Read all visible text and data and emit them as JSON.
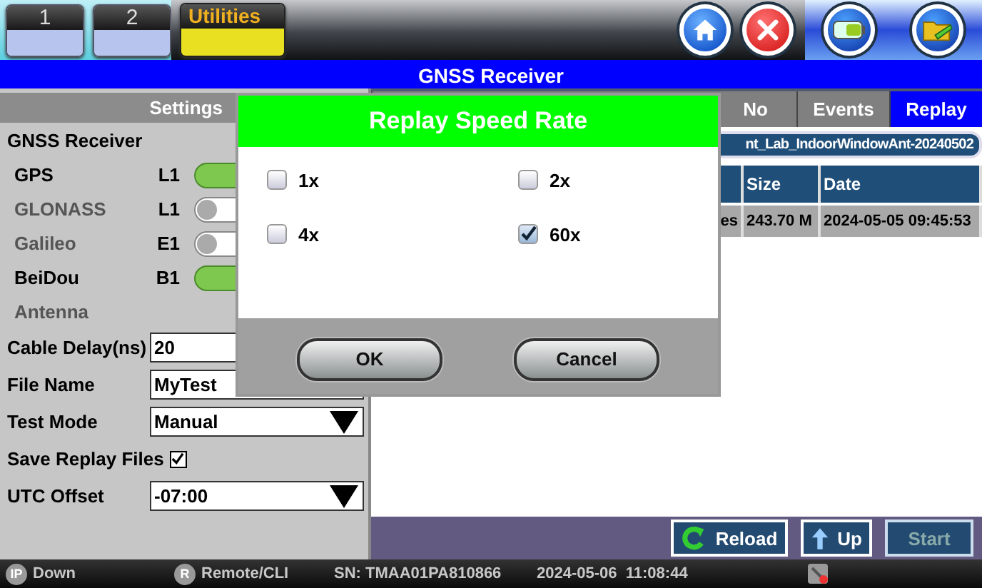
{
  "top_bar": {
    "tabs": [
      {
        "label": "1",
        "selected": false
      },
      {
        "label": "2",
        "selected": false
      },
      {
        "label": "Utilities",
        "selected": true
      }
    ]
  },
  "title_bar": {
    "title": "GNSS Receiver"
  },
  "settings": {
    "header": "Settings",
    "section": "GNSS Receiver",
    "constellations": [
      {
        "name": "GPS",
        "band": "L1",
        "on": true
      },
      {
        "name": "GLONASS",
        "band": "L1",
        "on": false
      },
      {
        "name": "Galileo",
        "band": "E1",
        "on": false
      },
      {
        "name": "BeiDou",
        "band": "B1",
        "on": true
      }
    ],
    "antenna_label": "Antenna",
    "fields": [
      {
        "kind": "text",
        "label": "Cable Delay(ns)",
        "value": "20"
      },
      {
        "kind": "text",
        "label": "File Name",
        "value": "MyTest"
      },
      {
        "kind": "select",
        "label": "Test Mode",
        "value": "Manual"
      },
      {
        "kind": "checkbox",
        "label": "Save Replay Files",
        "checked": true
      },
      {
        "kind": "select",
        "label": "UTC Offset",
        "value": "-07:00"
      }
    ]
  },
  "replay": {
    "tabs": [
      {
        "label": "No",
        "selected": false
      },
      {
        "label": "Events",
        "selected": false
      },
      {
        "label": "Replay",
        "selected": true
      }
    ],
    "path": "nt_Lab_IndoorWindowAnt-20240502",
    "columns": [
      "",
      "Size",
      "Date"
    ],
    "rows": [
      {
        "cells": [
          "es",
          "243.70 M",
          "2024-05-05 09:45:53"
        ]
      }
    ],
    "buttons": [
      {
        "kind": "reload",
        "label": "Reload",
        "disabled": false
      },
      {
        "kind": "up",
        "label": "Up",
        "disabled": false
      },
      {
        "kind": "plain",
        "label": "Start",
        "disabled": true
      }
    ]
  },
  "dialog": {
    "title": "Replay Speed Rate",
    "options": [
      {
        "label": "1x",
        "checked": false
      },
      {
        "label": "2x",
        "checked": false
      },
      {
        "label": "4x",
        "checked": false
      },
      {
        "label": "60x",
        "checked": true
      }
    ],
    "buttons": [
      "OK",
      "Cancel"
    ]
  },
  "status_bar": {
    "items": [
      {
        "kind": "badge",
        "badge": "IP",
        "text": "Down"
      },
      {
        "kind": "badge",
        "badge": "R",
        "text": "Remote/CLI"
      },
      {
        "kind": "plain",
        "text": "SN: TMAA01PA810866"
      },
      {
        "kind": "plain",
        "text": "2024-05-06  11:08:44"
      }
    ]
  }
}
